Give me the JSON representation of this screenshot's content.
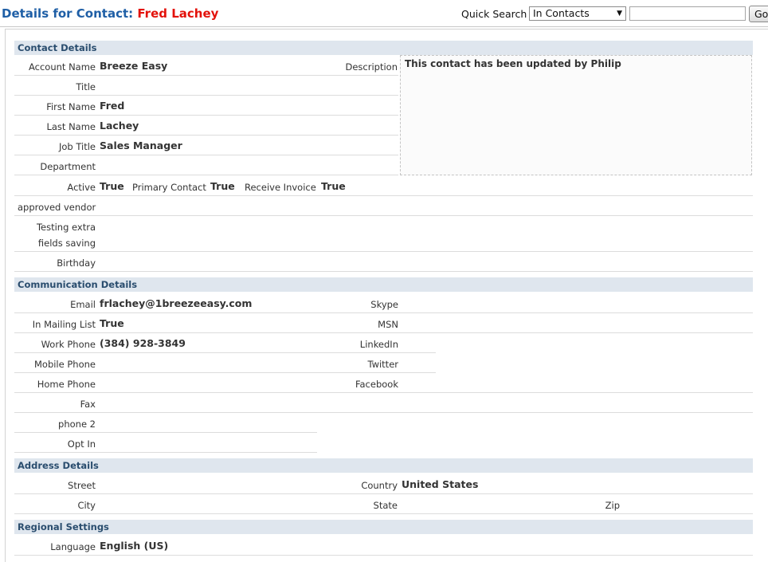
{
  "header": {
    "title_prefix": "Details for Contact:",
    "title_name": "Fred Lachey",
    "quick_search_label": "Quick Search",
    "quick_search_scope": "In Contacts",
    "quick_search_value": "",
    "go_label": "Go"
  },
  "contact": {
    "section_title": "Contact Details",
    "account_name_label": "Account Name",
    "account_name": "Breeze Easy",
    "title_label": "Title",
    "title": "",
    "first_name_label": "First Name",
    "first_name": "Fred",
    "last_name_label": "Last Name",
    "last_name": "Lachey",
    "job_title_label": "Job Title",
    "job_title": "Sales Manager",
    "department_label": "Department",
    "department": "",
    "description_label": "Description",
    "description": "This contact has been updated by Philip",
    "active_label": "Active",
    "active": "True",
    "primary_contact_label": "Primary Contact",
    "primary_contact": "True",
    "receive_invoice_label": "Receive Invoice",
    "receive_invoice": "True",
    "approved_vendor_label": "approved vendor",
    "testing_label_1": "Testing extra",
    "testing_label_2": "fields saving",
    "birthday_label": "Birthday"
  },
  "communication": {
    "section_title": "Communication Details",
    "email_label": "Email",
    "email": "frlachey@1breezeeasy.com",
    "mailing_label": "In Mailing List",
    "mailing": "True",
    "work_phone_label": "Work Phone",
    "work_phone": "(384) 928-3849",
    "mobile_phone_label": "Mobile Phone",
    "home_phone_label": "Home Phone",
    "fax_label": "Fax",
    "phone2_label": "phone 2",
    "opt_in_label": "Opt In",
    "skype_label": "Skype",
    "msn_label": "MSN",
    "linkedin_label": "LinkedIn",
    "twitter_label": "Twitter",
    "facebook_label": "Facebook"
  },
  "address": {
    "section_title": "Address Details",
    "street_label": "Street",
    "city_label": "City",
    "country_label": "Country",
    "country": "United States",
    "state_label": "State",
    "zip_label": "Zip"
  },
  "regional": {
    "section_title": "Regional Settings",
    "language_label": "Language",
    "language": "English (US)"
  }
}
